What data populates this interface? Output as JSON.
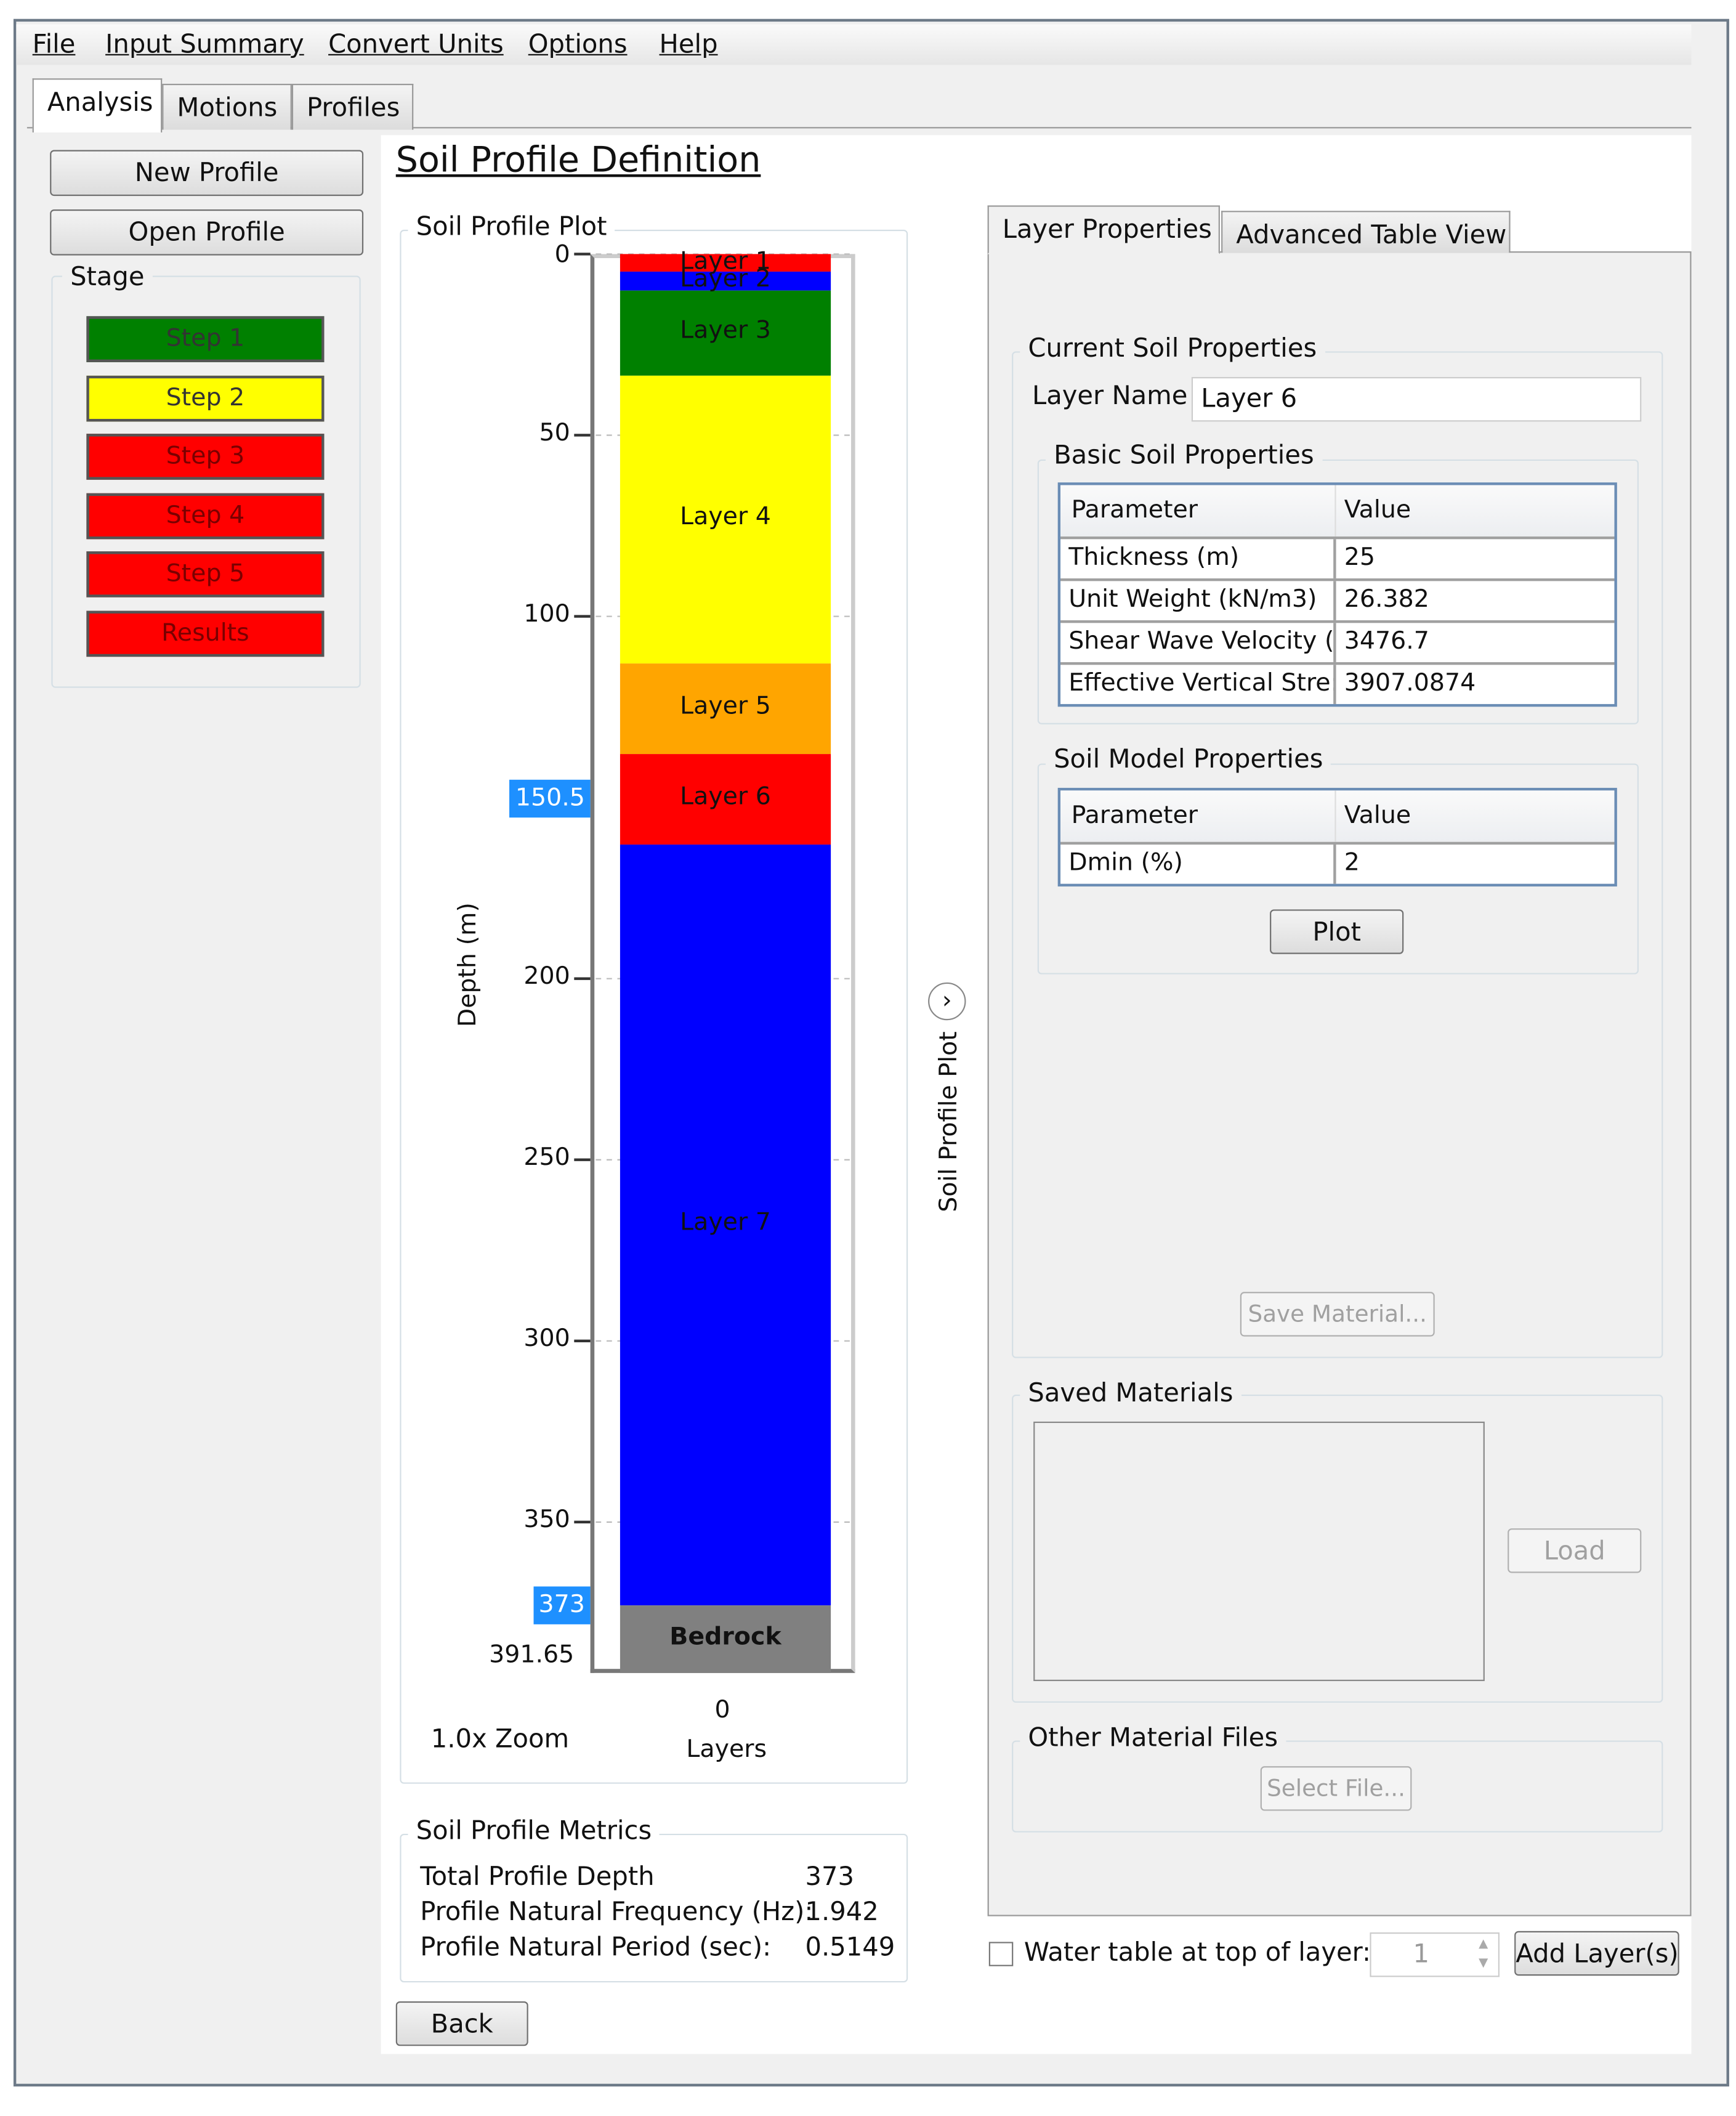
{
  "menu": {
    "items": [
      "File",
      "Input Summary",
      "Convert Units",
      "Options",
      "Help"
    ]
  },
  "tabs": [
    {
      "label": "Analysis",
      "active": true
    },
    {
      "label": "Motions"
    },
    {
      "label": "Profiles"
    }
  ],
  "left": {
    "new_profile": "New Profile",
    "open_profile": "Open Profile",
    "stage_label": "Stage",
    "steps": [
      {
        "label": "Step 1",
        "color": "#008000"
      },
      {
        "label": "Step 2",
        "color": "#ffff00"
      },
      {
        "label": "Step 3",
        "color": "#ff0000"
      },
      {
        "label": "Step 4",
        "color": "#ff0000"
      },
      {
        "label": "Step 5",
        "color": "#ff0000"
      },
      {
        "label": "Results",
        "color": "#ff0000"
      }
    ]
  },
  "main": {
    "title": "Soil Profile Definition",
    "plot_group": "Soil Profile Plot",
    "zoom": "1.0x Zoom",
    "side_toggle": "Soil Profile Plot",
    "metrics": {
      "label": "Soil Profile Metrics",
      "rows": [
        {
          "name": "Total Profile Depth",
          "value": "373"
        },
        {
          "name": "Profile Natural Frequency (Hz):",
          "value": "1.942"
        },
        {
          "name": "Profile Natural Period (sec):",
          "value": "0.5149"
        }
      ]
    },
    "back": "Back"
  },
  "chart_data": {
    "type": "bar",
    "ylabel": "Depth (m)",
    "xlabel": "Layers",
    "x_tick": "0",
    "y_ticks": [
      "0",
      "50",
      "100",
      "200",
      "250",
      "300",
      "350"
    ],
    "ylim": [
      0,
      391.65
    ],
    "y_max_label": "391.65",
    "highlights": [
      "150.5",
      "373"
    ],
    "grid": true,
    "layers": [
      {
        "name": "Layer 1",
        "top": 0,
        "bottom": 5,
        "color": "#ff0000"
      },
      {
        "name": "Layer 2",
        "top": 5,
        "bottom": 10,
        "color": "#0000ff"
      },
      {
        "name": "Layer 3",
        "top": 10,
        "bottom": 33.5,
        "color": "#008000"
      },
      {
        "name": "Layer 4",
        "top": 33.5,
        "bottom": 113,
        "color": "#ffff00"
      },
      {
        "name": "Layer 5",
        "top": 113,
        "bottom": 138,
        "color": "#ffa500"
      },
      {
        "name": "Layer 6",
        "top": 138,
        "bottom": 163,
        "color": "#ff0000"
      },
      {
        "name": "Layer 7",
        "top": 163,
        "bottom": 373,
        "color": "#0000ff"
      },
      {
        "name": "Bedrock",
        "top": 373,
        "bottom": 391.65,
        "color": "#808080"
      }
    ]
  },
  "right": {
    "tabs": [
      "Layer Properties",
      "Advanced Table View"
    ],
    "current_group": "Current Soil Properties",
    "layer_name_label": "Layer Name",
    "layer_name_value": "Layer 6",
    "basic_group": "Basic Soil Properties",
    "basic_table": {
      "headers": [
        "Parameter",
        "Value"
      ],
      "rows": [
        [
          "Thickness (m)",
          "25"
        ],
        [
          "Unit Weight (kN/m3)",
          "26.382"
        ],
        [
          "Shear Wave Velocity (",
          "3476.7"
        ],
        [
          "Effective Vertical Stre:",
          "3907.0874"
        ]
      ]
    },
    "model_group": "Soil Model Properties",
    "model_table": {
      "headers": [
        "Parameter",
        "Value"
      ],
      "rows": [
        [
          "Dmin (%)",
          "2"
        ]
      ]
    },
    "plot": "Plot",
    "save_material": "Save Material...",
    "saved_group": "Saved Materials",
    "load": "Load",
    "other_group": "Other Material Files",
    "select_file": "Select File...",
    "water_table_label": "Water table at top of layer:",
    "water_table_value": "1",
    "add_layers": "Add Layer(s)"
  }
}
